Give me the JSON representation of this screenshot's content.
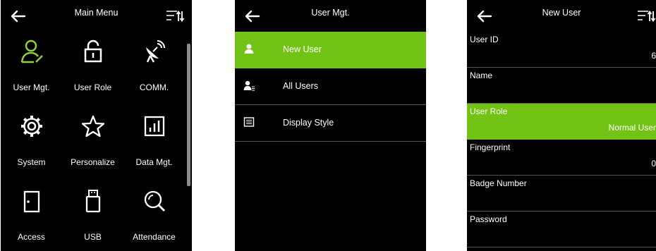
{
  "screens": {
    "main_menu": {
      "title": "Main Menu",
      "items": [
        {
          "label": "User Mgt."
        },
        {
          "label": "User Role"
        },
        {
          "label": "COMM."
        },
        {
          "label": "System"
        },
        {
          "label": "Personalize"
        },
        {
          "label": "Data Mgt."
        },
        {
          "label": "Access"
        },
        {
          "label": "USB"
        },
        {
          "label": "Attendance"
        }
      ]
    },
    "user_mgt": {
      "title": "User Mgt.",
      "items": [
        {
          "label": "New User"
        },
        {
          "label": "All Users"
        },
        {
          "label": "Display Style"
        }
      ]
    },
    "new_user": {
      "title": "New User",
      "fields": [
        {
          "label": "User ID",
          "value": "6"
        },
        {
          "label": "Name",
          "value": ""
        },
        {
          "label": "User Role",
          "value": "Normal User"
        },
        {
          "label": "Fingerprint",
          "value": "0"
        },
        {
          "label": "Badge Number",
          "value": ""
        },
        {
          "label": "Password",
          "value": ""
        }
      ]
    }
  },
  "colors": {
    "accent": "#73c317",
    "background": "#000000",
    "text": "#ffffff",
    "divider": "#555555"
  },
  "icons": {
    "header": [
      "back-arrow-icon",
      "sort-icon"
    ],
    "main_menu": [
      "user-icon",
      "lock-icon",
      "satellite-dish-icon",
      "gear-icon",
      "star-icon",
      "bar-chart-icon",
      "door-icon",
      "usb-icon",
      "magnifier-icon"
    ],
    "user_mgt": [
      "user-icon",
      "users-list-icon",
      "display-style-icon"
    ]
  }
}
